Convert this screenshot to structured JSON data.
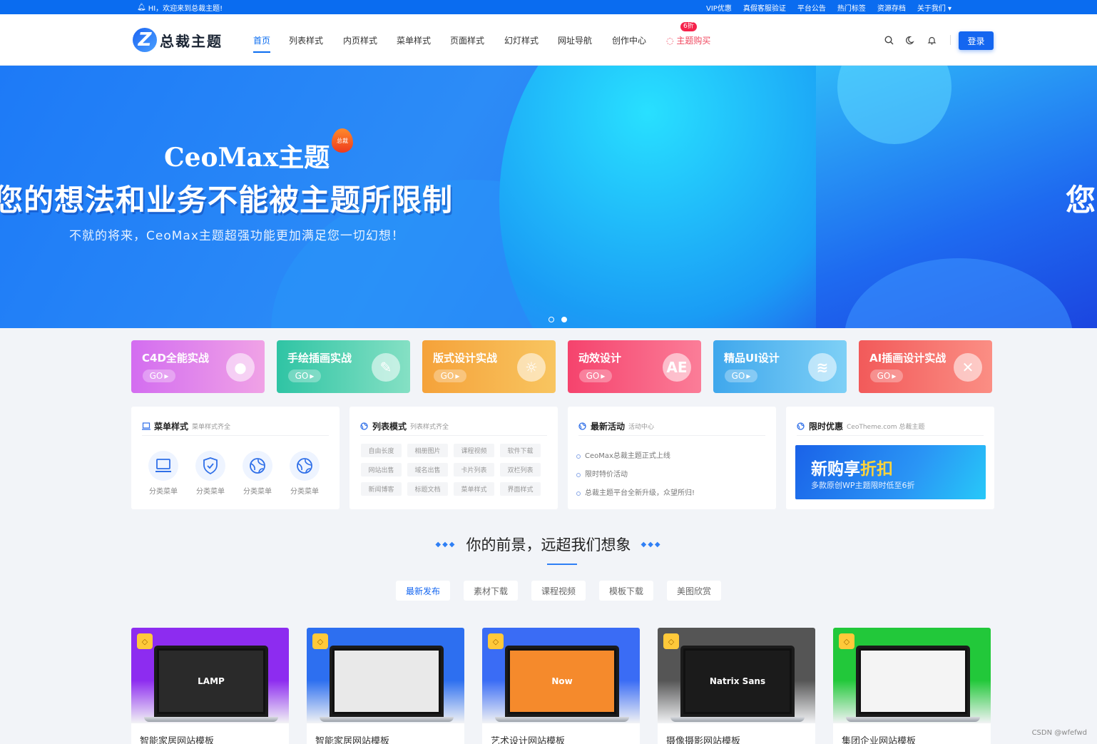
{
  "topbar": {
    "welcome": "HI，欢迎来到总裁主题!",
    "links": [
      "VIP优惠",
      "真假客服验证",
      "平台公告",
      "热门标签",
      "资源存档",
      "关于我们"
    ]
  },
  "header": {
    "logo_text": "总裁主题",
    "nav": [
      {
        "label": "首页",
        "active": true
      },
      {
        "label": "列表样式"
      },
      {
        "label": "内页样式"
      },
      {
        "label": "菜单样式"
      },
      {
        "label": "页面样式"
      },
      {
        "label": "幻灯样式"
      },
      {
        "label": "网址导航"
      },
      {
        "label": "创作中心"
      }
    ],
    "buy_label": "主题购买",
    "buy_badge": "6折",
    "login_label": "登录",
    "icons": [
      "search-icon",
      "theme-toggle-icon",
      "bell-icon"
    ]
  },
  "banner": {
    "title": "CeoMax主题",
    "drop_label": "总裁",
    "headline": "您的想法和业务不能被主题所限制",
    "headline_next": "您",
    "subtitle": "不就的将来，CeoMax主题超强功能更加满足您一切幻想！",
    "slides": 2,
    "active_slide": 2
  },
  "categories": [
    {
      "title": "C4D全能实战",
      "go": "GO",
      "color_from": "#d36df0",
      "color_to": "#f0a2e6",
      "deco": "●"
    },
    {
      "title": "手绘插画实战",
      "go": "GO",
      "color_from": "#2fc4a4",
      "color_to": "#85e0c4",
      "deco": "✎"
    },
    {
      "title": "版式设计实战",
      "go": "GO",
      "color_from": "#f5a23a",
      "color_to": "#f8c560",
      "deco": "☼"
    },
    {
      "title": "动效设计",
      "go": "GO",
      "color_from": "#f5436d",
      "color_to": "#fb7d98",
      "deco": "AE"
    },
    {
      "title": "精品UI设计",
      "go": "GO",
      "color_from": "#3fa7ec",
      "color_to": "#7ed0f6",
      "deco": "≋"
    },
    {
      "title": "AI插画设计实战",
      "go": "GO",
      "color_from": "#f25a5a",
      "color_to": "#fb8e84",
      "deco": "✕"
    }
  ],
  "panels": {
    "menu": {
      "title": "菜单样式",
      "subtitle": "菜单样式齐全",
      "items": [
        "分类菜单",
        "分类菜单",
        "分类菜单",
        "分类菜单"
      ]
    },
    "list": {
      "title": "列表模式",
      "subtitle": "列表样式齐全",
      "tags": [
        "自由长度",
        "相册图片",
        "课程视频",
        "软件下载",
        "网站出售",
        "域名出售",
        "卡片列表",
        "双栏列表",
        "新闻博客",
        "标题文档",
        "菜单样式",
        "界面样式"
      ]
    },
    "activity": {
      "title": "最新活动",
      "subtitle": "活动中心",
      "items": [
        "CeoMax总裁主题正式上线",
        "限时特价活动",
        "总裁主题平台全新升级，众望所归!"
      ]
    },
    "promo": {
      "title": "限时优惠",
      "subtitle": "CeoTheme.com 总裁主题",
      "big_prefix": "新购享",
      "big_highlight": "折扣",
      "small": "多款原创WP主题限时低至6折"
    }
  },
  "section": {
    "heading": "你的前景，远超我们想象",
    "tabs": [
      {
        "label": "最新发布",
        "active": true
      },
      {
        "label": "素材下载"
      },
      {
        "label": "课程视频"
      },
      {
        "label": "模板下载"
      },
      {
        "label": "美图欣赏"
      }
    ]
  },
  "posts": [
    {
      "title": "智能家居网站模板",
      "bg": "#8d2cf0",
      "screen_text": "LAMP",
      "screen_bg": "#2a2a2a"
    },
    {
      "title": "智能家居网站模板",
      "bg": "#2d6ff0",
      "screen_text": "",
      "screen_bg": "#e9e9e9"
    },
    {
      "title": "艺术设计网站模板",
      "bg": "#3a6cf5",
      "screen_text": "Now",
      "screen_bg": "#f58a2c"
    },
    {
      "title": "摄像摄影网站模板",
      "bg": "#555555",
      "screen_text": "Natrix Sans",
      "screen_bg": "#1b1b1b"
    },
    {
      "title": "集团企业网站模板",
      "bg": "#22c83a",
      "screen_text": "",
      "screen_bg": "#f4f4f4"
    }
  ],
  "watermark": "CSDN @wfefwd"
}
